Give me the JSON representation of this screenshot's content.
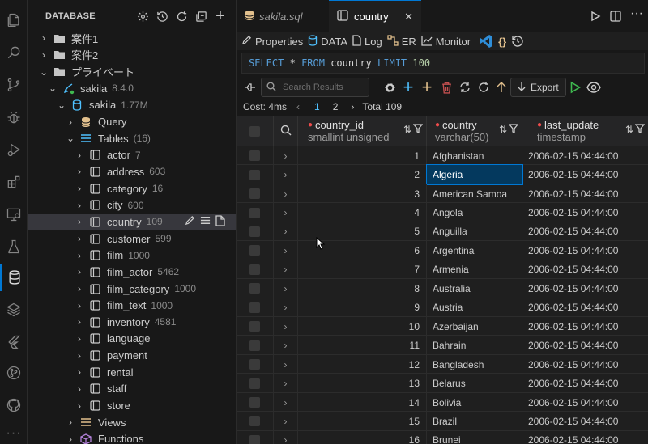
{
  "sidebar": {
    "title": "DATABASE",
    "tree": [
      {
        "label": "案件1",
        "count": "",
        "icon": "folder-icon",
        "depth": 0,
        "chev": "›"
      },
      {
        "label": "案件2",
        "count": "",
        "icon": "folder-icon",
        "depth": 0,
        "chev": "›"
      },
      {
        "label": "プライベート",
        "count": "",
        "icon": "folder-icon",
        "depth": 0,
        "chev": "⌄"
      },
      {
        "label": "sakila",
        "count": "8.4.0",
        "icon": "connection-icon",
        "depth": 1,
        "chev": "⌄"
      },
      {
        "label": "sakila",
        "count": "1.77M",
        "icon": "database-icon",
        "depth": 2,
        "chev": "⌄"
      },
      {
        "label": "Query",
        "count": "",
        "icon": "query-icon",
        "depth": 3,
        "chev": "›"
      },
      {
        "label": "Tables",
        "count": "(16)",
        "icon": "tables-icon",
        "depth": 3,
        "chev": "⌄"
      },
      {
        "label": "actor",
        "count": "7",
        "icon": "table-icon",
        "depth": 4,
        "chev": "›"
      },
      {
        "label": "address",
        "count": "603",
        "icon": "table-icon",
        "depth": 4,
        "chev": "›"
      },
      {
        "label": "category",
        "count": "16",
        "icon": "table-icon",
        "depth": 4,
        "chev": "›"
      },
      {
        "label": "city",
        "count": "600",
        "icon": "table-icon",
        "depth": 4,
        "chev": "›"
      },
      {
        "label": "country",
        "count": "109",
        "icon": "table-icon",
        "depth": 4,
        "chev": "›",
        "selected": true
      },
      {
        "label": "customer",
        "count": "599",
        "icon": "table-icon",
        "depth": 4,
        "chev": "›"
      },
      {
        "label": "film",
        "count": "1000",
        "icon": "table-icon",
        "depth": 4,
        "chev": "›"
      },
      {
        "label": "film_actor",
        "count": "5462",
        "icon": "table-icon",
        "depth": 4,
        "chev": "›"
      },
      {
        "label": "film_category",
        "count": "1000",
        "icon": "table-icon",
        "depth": 4,
        "chev": "›"
      },
      {
        "label": "film_text",
        "count": "1000",
        "icon": "table-icon",
        "depth": 4,
        "chev": "›"
      },
      {
        "label": "inventory",
        "count": "4581",
        "icon": "table-icon",
        "depth": 4,
        "chev": "›"
      },
      {
        "label": "language",
        "count": "",
        "icon": "table-icon",
        "depth": 4,
        "chev": "›"
      },
      {
        "label": "payment",
        "count": "",
        "icon": "table-icon",
        "depth": 4,
        "chev": "›"
      },
      {
        "label": "rental",
        "count": "",
        "icon": "table-icon",
        "depth": 4,
        "chev": "›"
      },
      {
        "label": "staff",
        "count": "",
        "icon": "table-icon",
        "depth": 4,
        "chev": "›"
      },
      {
        "label": "store",
        "count": "",
        "icon": "table-icon",
        "depth": 4,
        "chev": "›"
      },
      {
        "label": "Views",
        "count": "",
        "icon": "views-icon",
        "depth": 3,
        "chev": "›"
      },
      {
        "label": "Functions",
        "count": "",
        "icon": "functions-icon",
        "depth": 3,
        "chev": "›"
      }
    ]
  },
  "tabs": [
    {
      "label": "sakila.sql",
      "icon": "database-file-icon",
      "active": false
    },
    {
      "label": "country",
      "icon": "table-view-icon",
      "active": true
    }
  ],
  "toolbar": {
    "properties": "Properties",
    "data": "DATA",
    "log": "Log",
    "er": "ER",
    "monitor": "Monitor"
  },
  "sql": {
    "select": "SELECT",
    "star": "*",
    "from": "FROM",
    "table": "country",
    "limit": "LIMIT",
    "limit_value": "100"
  },
  "search": {
    "placeholder": "Search Results"
  },
  "export_label": "Export",
  "status": {
    "cost": "Cost: 4ms",
    "pages": [
      "1",
      "2"
    ],
    "current_page": "1",
    "total": "Total 109"
  },
  "columns": [
    {
      "name": "country_id",
      "type": "smallint unsigned"
    },
    {
      "name": "country",
      "type": "varchar(50)"
    },
    {
      "name": "last_update",
      "type": "timestamp"
    }
  ],
  "rows": [
    {
      "id": "1",
      "country": "Afghanistan",
      "last_update": "2006-02-15 04:44:00"
    },
    {
      "id": "2",
      "country": "Algeria",
      "last_update": "2006-02-15 04:44:00",
      "selected": true
    },
    {
      "id": "3",
      "country": "American Samoa",
      "last_update": "2006-02-15 04:44:00"
    },
    {
      "id": "4",
      "country": "Angola",
      "last_update": "2006-02-15 04:44:00"
    },
    {
      "id": "5",
      "country": "Anguilla",
      "last_update": "2006-02-15 04:44:00"
    },
    {
      "id": "6",
      "country": "Argentina",
      "last_update": "2006-02-15 04:44:00"
    },
    {
      "id": "7",
      "country": "Armenia",
      "last_update": "2006-02-15 04:44:00"
    },
    {
      "id": "8",
      "country": "Australia",
      "last_update": "2006-02-15 04:44:00"
    },
    {
      "id": "9",
      "country": "Austria",
      "last_update": "2006-02-15 04:44:00"
    },
    {
      "id": "10",
      "country": "Azerbaijan",
      "last_update": "2006-02-15 04:44:00"
    },
    {
      "id": "11",
      "country": "Bahrain",
      "last_update": "2006-02-15 04:44:00"
    },
    {
      "id": "12",
      "country": "Bangladesh",
      "last_update": "2006-02-15 04:44:00"
    },
    {
      "id": "13",
      "country": "Belarus",
      "last_update": "2006-02-15 04:44:00"
    },
    {
      "id": "14",
      "country": "Bolivia",
      "last_update": "2006-02-15 04:44:00"
    },
    {
      "id": "15",
      "country": "Brazil",
      "last_update": "2006-02-15 04:44:00"
    },
    {
      "id": "16",
      "country": "Brunei",
      "last_update": "2006-02-15 04:44:00"
    }
  ],
  "colors": {
    "accent": "#0078d4",
    "selection": "#04395e",
    "keyword": "#569cd6",
    "number": "#b5cea8",
    "required_dot": "#f14c4c"
  }
}
